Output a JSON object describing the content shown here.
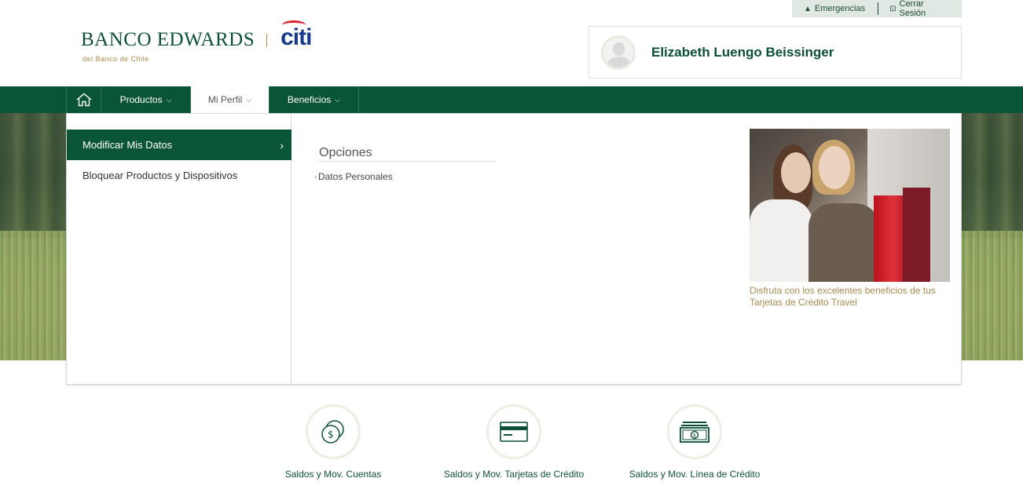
{
  "utility": {
    "emergencias": "Emergencias",
    "cerrar_sesion": "Cerrar Sesión"
  },
  "logo": {
    "main": "BANCO EDWARDS",
    "partner": "citi",
    "sub": "del Banco de Chile"
  },
  "user": {
    "name": "Elizabeth Luengo Beissinger"
  },
  "nav": {
    "items": [
      {
        "label": "Productos",
        "icon": "chevron-down-icon"
      },
      {
        "label": "Mi Perfil",
        "icon": "chevron-down-icon",
        "active": true
      },
      {
        "label": "Beneficios",
        "icon": "chevron-down-icon"
      }
    ],
    "home_icon": "home-icon"
  },
  "menu": {
    "left_items": [
      {
        "label": "Modificar Mis Datos",
        "active": true
      },
      {
        "label": "Bloquear Productos y Dispositivos"
      }
    ],
    "options_title": "Opciones",
    "options_links": [
      "Datos Personales"
    ],
    "promo_caption": "Disfruta con los excelentes beneficios de tus Tarjetas de Crédito Travel"
  },
  "shortcuts": [
    {
      "label": "Saldos y Mov. Cuentas",
      "icon": "coins-icon"
    },
    {
      "label": "Saldos y Mov. Tarjetas de Crédito",
      "icon": "credit-card-icon"
    },
    {
      "label": "Saldos y Mov. Línea de Crédito",
      "icon": "banknote-icon"
    }
  ],
  "colors": {
    "brand_green": "#0a5538",
    "gold": "#a88a50",
    "citi_blue": "#183a8c",
    "citi_red": "#d6262d"
  }
}
